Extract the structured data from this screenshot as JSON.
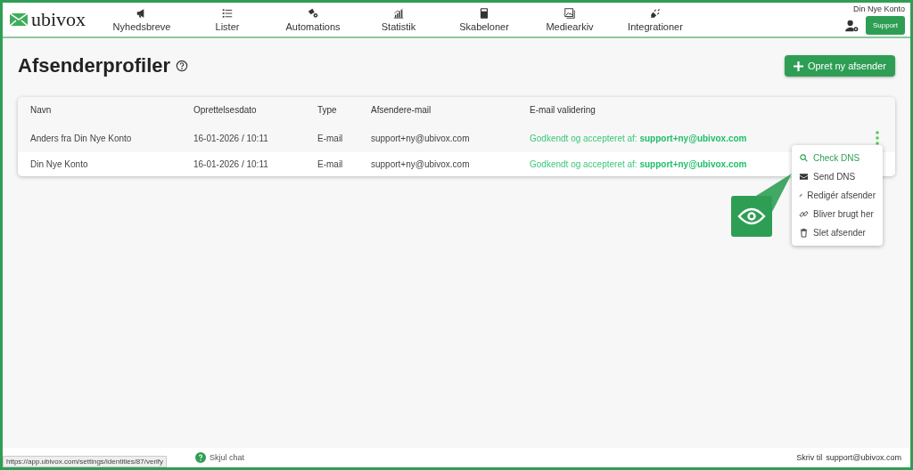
{
  "header": {
    "logo": "ubivox",
    "nav": [
      {
        "label": "Nyhedsbreve"
      },
      {
        "label": "Lister"
      },
      {
        "label": "Automations"
      },
      {
        "label": "Statistik"
      },
      {
        "label": "Skabeloner"
      },
      {
        "label": "Mediearkiv"
      },
      {
        "label": "Integrationer"
      }
    ],
    "account": "Din Nye Konto",
    "support_button": "Support"
  },
  "page": {
    "title": "Afsenderprofiler",
    "create_button": "Opret ny afsender"
  },
  "table": {
    "columns": [
      "Navn",
      "Oprettelsesdato",
      "Type",
      "Afsendere-mail",
      "E-mail validering"
    ],
    "rows": [
      {
        "name": "Anders fra Din Nye Konto",
        "created": "16-01-2026 / 10:11",
        "type": "E-mail",
        "email": "support+ny@ubivox.com",
        "validation": "Godkendt og accepteret af: **support+ny@ubivox.com**",
        "highlighted": true
      },
      {
        "name": "Din Nye Konto",
        "created": "16-01-2026 / 10:11",
        "type": "E-mail",
        "email": "support+ny@ubivox.com",
        "validation": "Godkendt og accepteret af: **support+ny@ubivox.com**",
        "highlighted": false
      }
    ]
  },
  "row_menu": {
    "items": [
      {
        "label": "Check DNS",
        "selected": true
      },
      {
        "label": "Send DNS",
        "selected": false
      },
      {
        "label": "Redigér afsender",
        "selected": false
      },
      {
        "label": "Bliver brugt her",
        "selected": false
      },
      {
        "label": "Slet afsender",
        "selected": false
      }
    ]
  },
  "footer": {
    "chat": "Skjul chat",
    "contact": "Skriv til",
    "contact_link": "support@ubivox.com"
  },
  "status_bar": {
    "url": "https://app.ubivox.com/settings/identities/87/verify"
  }
}
